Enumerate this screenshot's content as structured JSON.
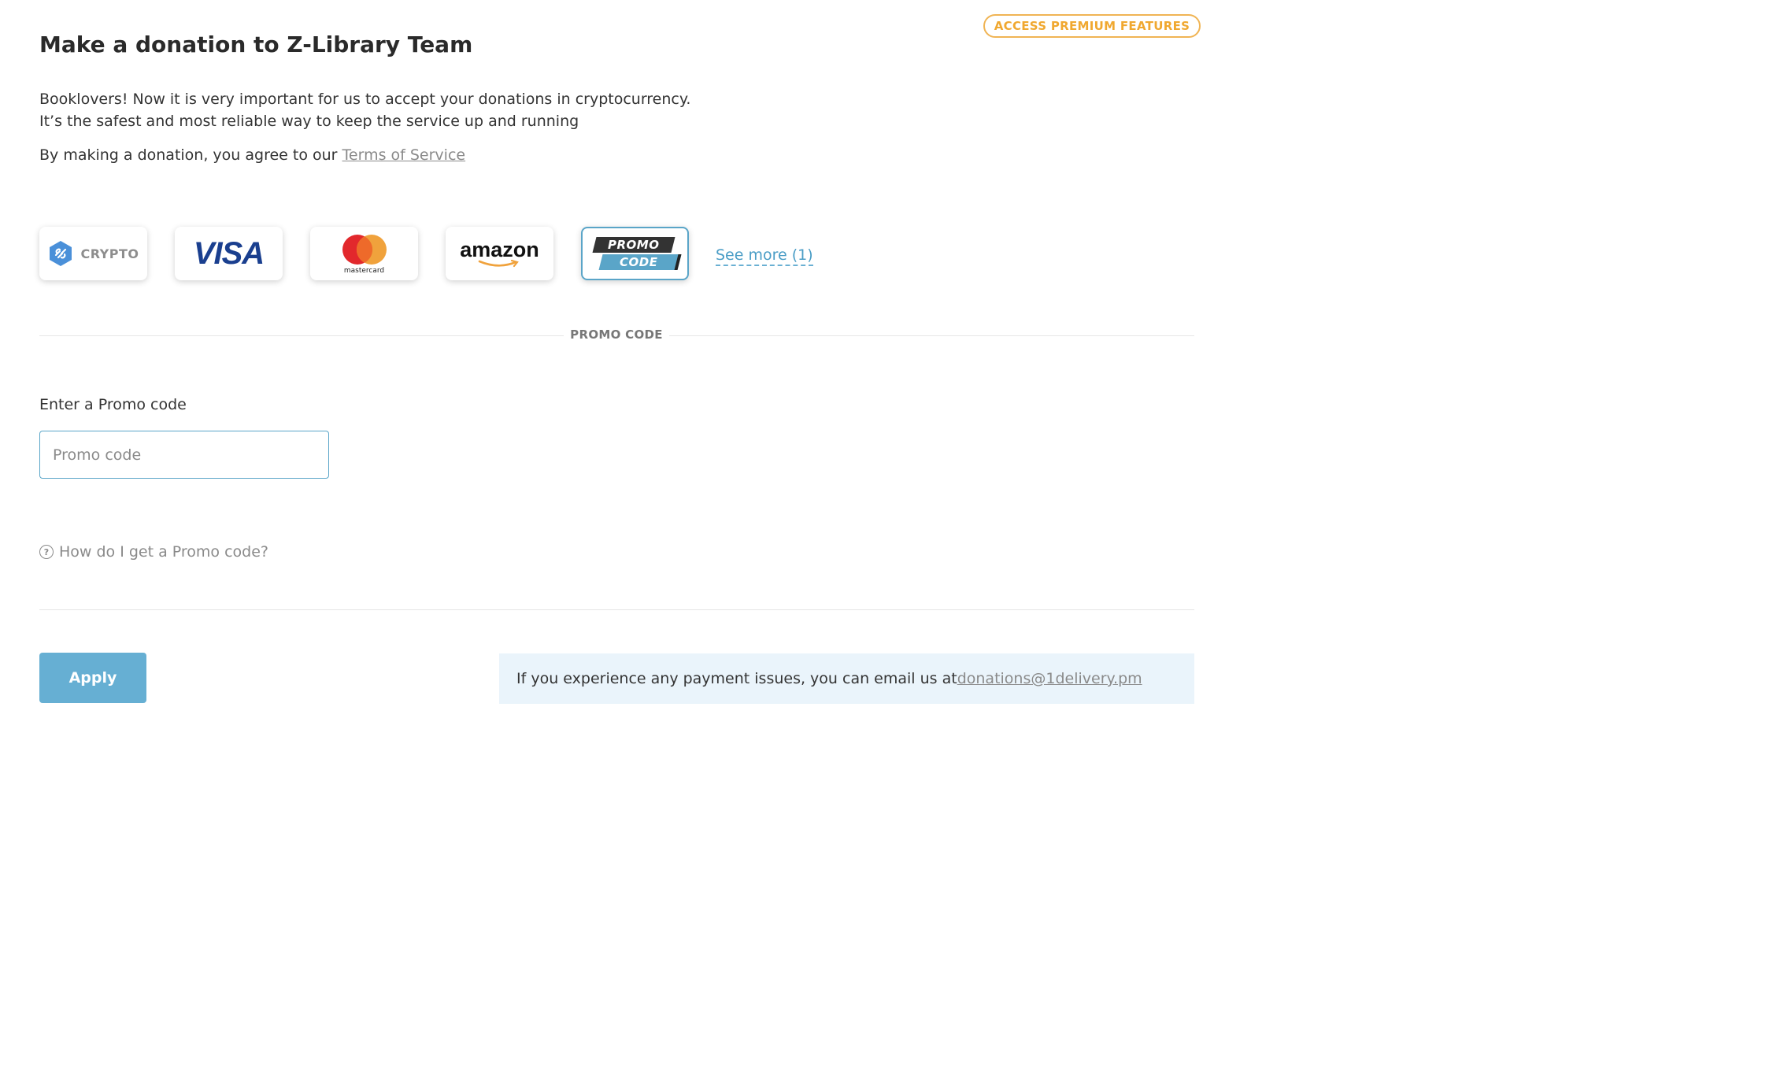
{
  "header": {
    "premium_label": "ACCESS PREMIUM FEATURES",
    "title": "Make a donation to Z-Library Team"
  },
  "intro": {
    "line1": "Booklovers! Now it is very important for us to accept your donations in cryptocurrency.",
    "line2": "It’s the safest and most reliable way to keep the service up and running",
    "agree_prefix": "By making a donation, you agree to our ",
    "terms_link": "Terms of Service"
  },
  "payment_methods": {
    "crypto_label": "CRYPTO",
    "visa_label": "VISA",
    "mastercard_label": "mastercard",
    "amazon_label": "amazon",
    "promo_line1": "PROMO",
    "promo_line2": "CODE",
    "selected": "promo-code",
    "see_more": "See more (1)"
  },
  "section": {
    "label": "PROMO CODE"
  },
  "form": {
    "field_label": "Enter a Promo code",
    "placeholder": "Promo code",
    "value": "",
    "help_text": "How do I get a Promo code?",
    "apply_label": "Apply"
  },
  "notice": {
    "text": "If you experience any payment issues, you can email us at ",
    "email": "donations@1delivery.pm"
  },
  "colors": {
    "accent": "#66afd3",
    "premium": "#f0b454",
    "visa": "#1a3f8f",
    "mastercard_red": "#e2282c",
    "mastercard_orange": "#f0a23c",
    "amazon_smile": "#f0a23c",
    "notice_bg": "#eaf4fb"
  },
  "icons": [
    "crypto-logo-icon",
    "mastercard-circles-icon",
    "amazon-smile-icon",
    "question-circle-icon"
  ]
}
